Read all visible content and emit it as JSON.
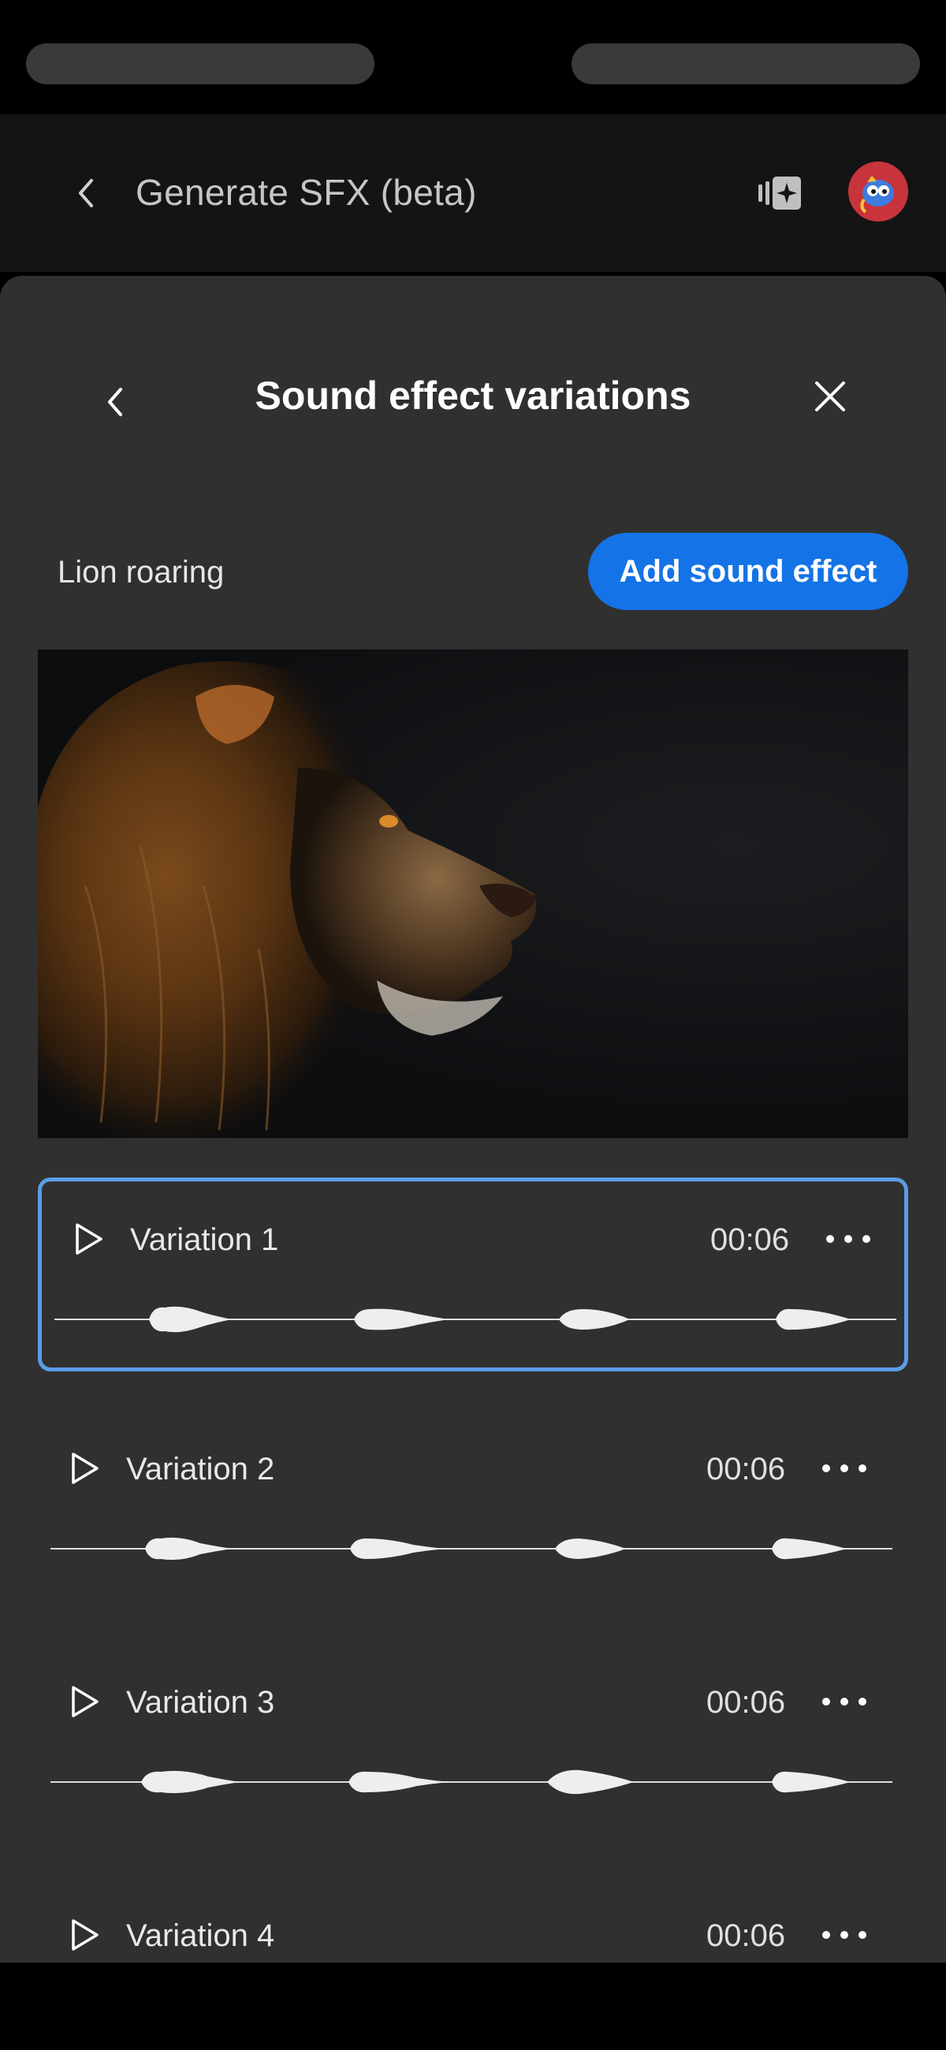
{
  "header": {
    "title": "Generate SFX (beta)"
  },
  "sheet": {
    "title": "Sound effect variations",
    "prompt": "Lion roaring",
    "add_button_label": "Add sound effect"
  },
  "variations": [
    {
      "name": "Variation 1",
      "duration": "00:06",
      "selected": true
    },
    {
      "name": "Variation 2",
      "duration": "00:06",
      "selected": false
    },
    {
      "name": "Variation 3",
      "duration": "00:06",
      "selected": false
    },
    {
      "name": "Variation 4",
      "duration": "00:06",
      "selected": false
    }
  ],
  "colors": {
    "accent": "#1473e6",
    "selected_border": "#5a9de6",
    "sheet_bg": "#303030"
  }
}
